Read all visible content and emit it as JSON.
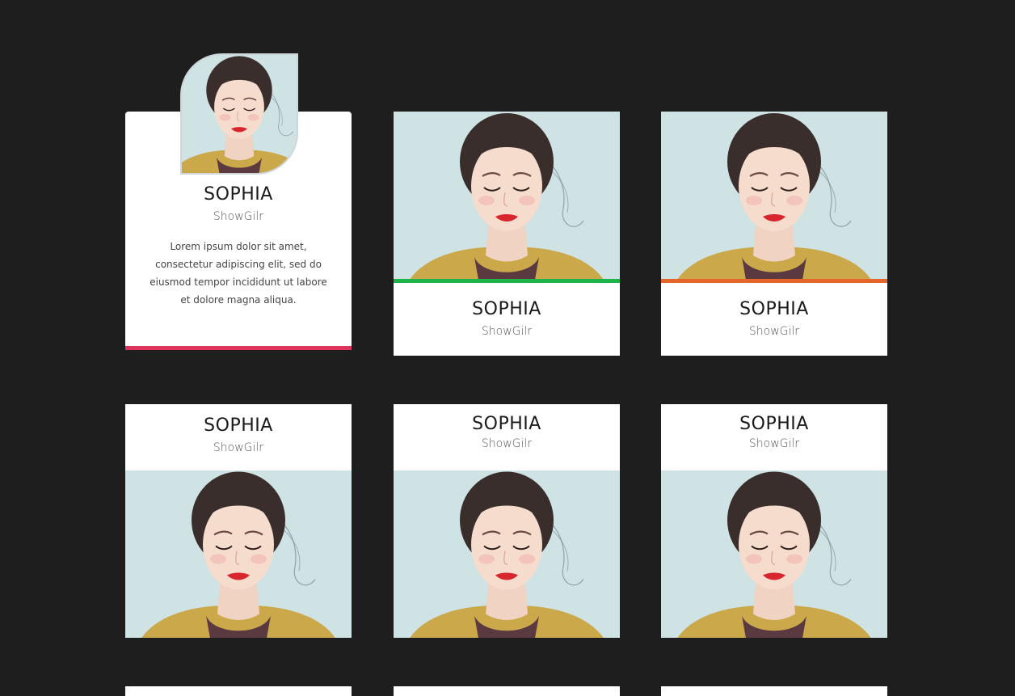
{
  "colors": {
    "background": "#1e1e1e",
    "card": "#ffffff",
    "accent_pink": "#e0335b",
    "accent_green": "#1db54a",
    "accent_orange": "#e4662a"
  },
  "cards": [
    {
      "name": "SOPHIA",
      "role": "ShowGilr",
      "description": "Lorem ipsum dolor sit amet, consectetur adipiscing elit, sed do eiusmod tempor incididunt ut labore et dolore magna aliqua.",
      "accent": "#e0335b"
    },
    {
      "name": "SOPHIA",
      "role": "ShowGilr",
      "accent": "#1db54a"
    },
    {
      "name": "SOPHIA",
      "role": "ShowGilr",
      "accent": "#e4662a"
    },
    {
      "name": "SOPHIA",
      "role": "ShowGilr"
    },
    {
      "name": "SOPHIA",
      "role": "ShowGilr"
    },
    {
      "name": "SOPHIA",
      "role": "ShowGilr"
    }
  ]
}
